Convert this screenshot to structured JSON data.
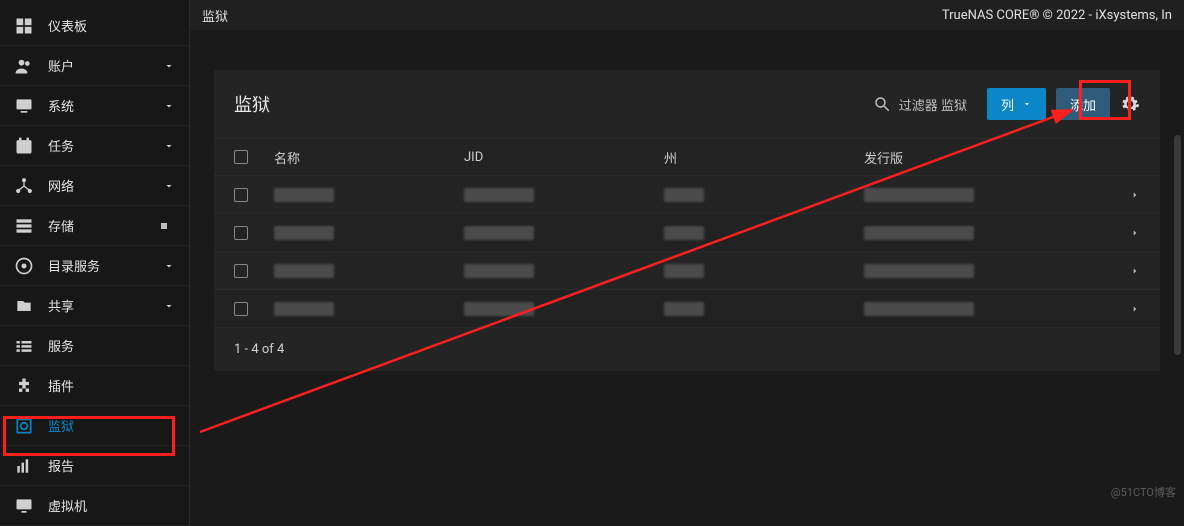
{
  "brand_sub": "CORE",
  "breadcrumb": "监狱",
  "copyright": "TrueNAS CORE® © 2022 - iXsystems, In",
  "sidebar": {
    "items": [
      {
        "label": "仪表板",
        "icon": "dashboard",
        "caret": false
      },
      {
        "label": "账户",
        "icon": "accounts",
        "caret": true
      },
      {
        "label": "系统",
        "icon": "system",
        "caret": true
      },
      {
        "label": "任务",
        "icon": "tasks",
        "caret": true
      },
      {
        "label": "网络",
        "icon": "network",
        "caret": true
      },
      {
        "label": "存储",
        "icon": "storage",
        "caret": false,
        "dot": true
      },
      {
        "label": "目录服务",
        "icon": "directory",
        "caret": true
      },
      {
        "label": "共享",
        "icon": "sharing",
        "caret": true
      },
      {
        "label": "服务",
        "icon": "services",
        "caret": false
      },
      {
        "label": "插件",
        "icon": "plugins",
        "caret": false
      },
      {
        "label": "监狱",
        "icon": "jails",
        "caret": false,
        "active": true
      },
      {
        "label": "报告",
        "icon": "reporting",
        "caret": false
      },
      {
        "label": "虚拟机",
        "icon": "vm",
        "caret": false
      }
    ]
  },
  "card": {
    "title": "监狱",
    "filter_placeholder": "过滤器 监狱",
    "columns_btn": "列",
    "add_btn": "添加"
  },
  "table": {
    "headers": {
      "name": "名称",
      "jid": "JID",
      "state": "州",
      "release": "发行版"
    },
    "pager": "1 - 4 of 4",
    "row_count": 4
  },
  "watermark": "@51CTO博客"
}
